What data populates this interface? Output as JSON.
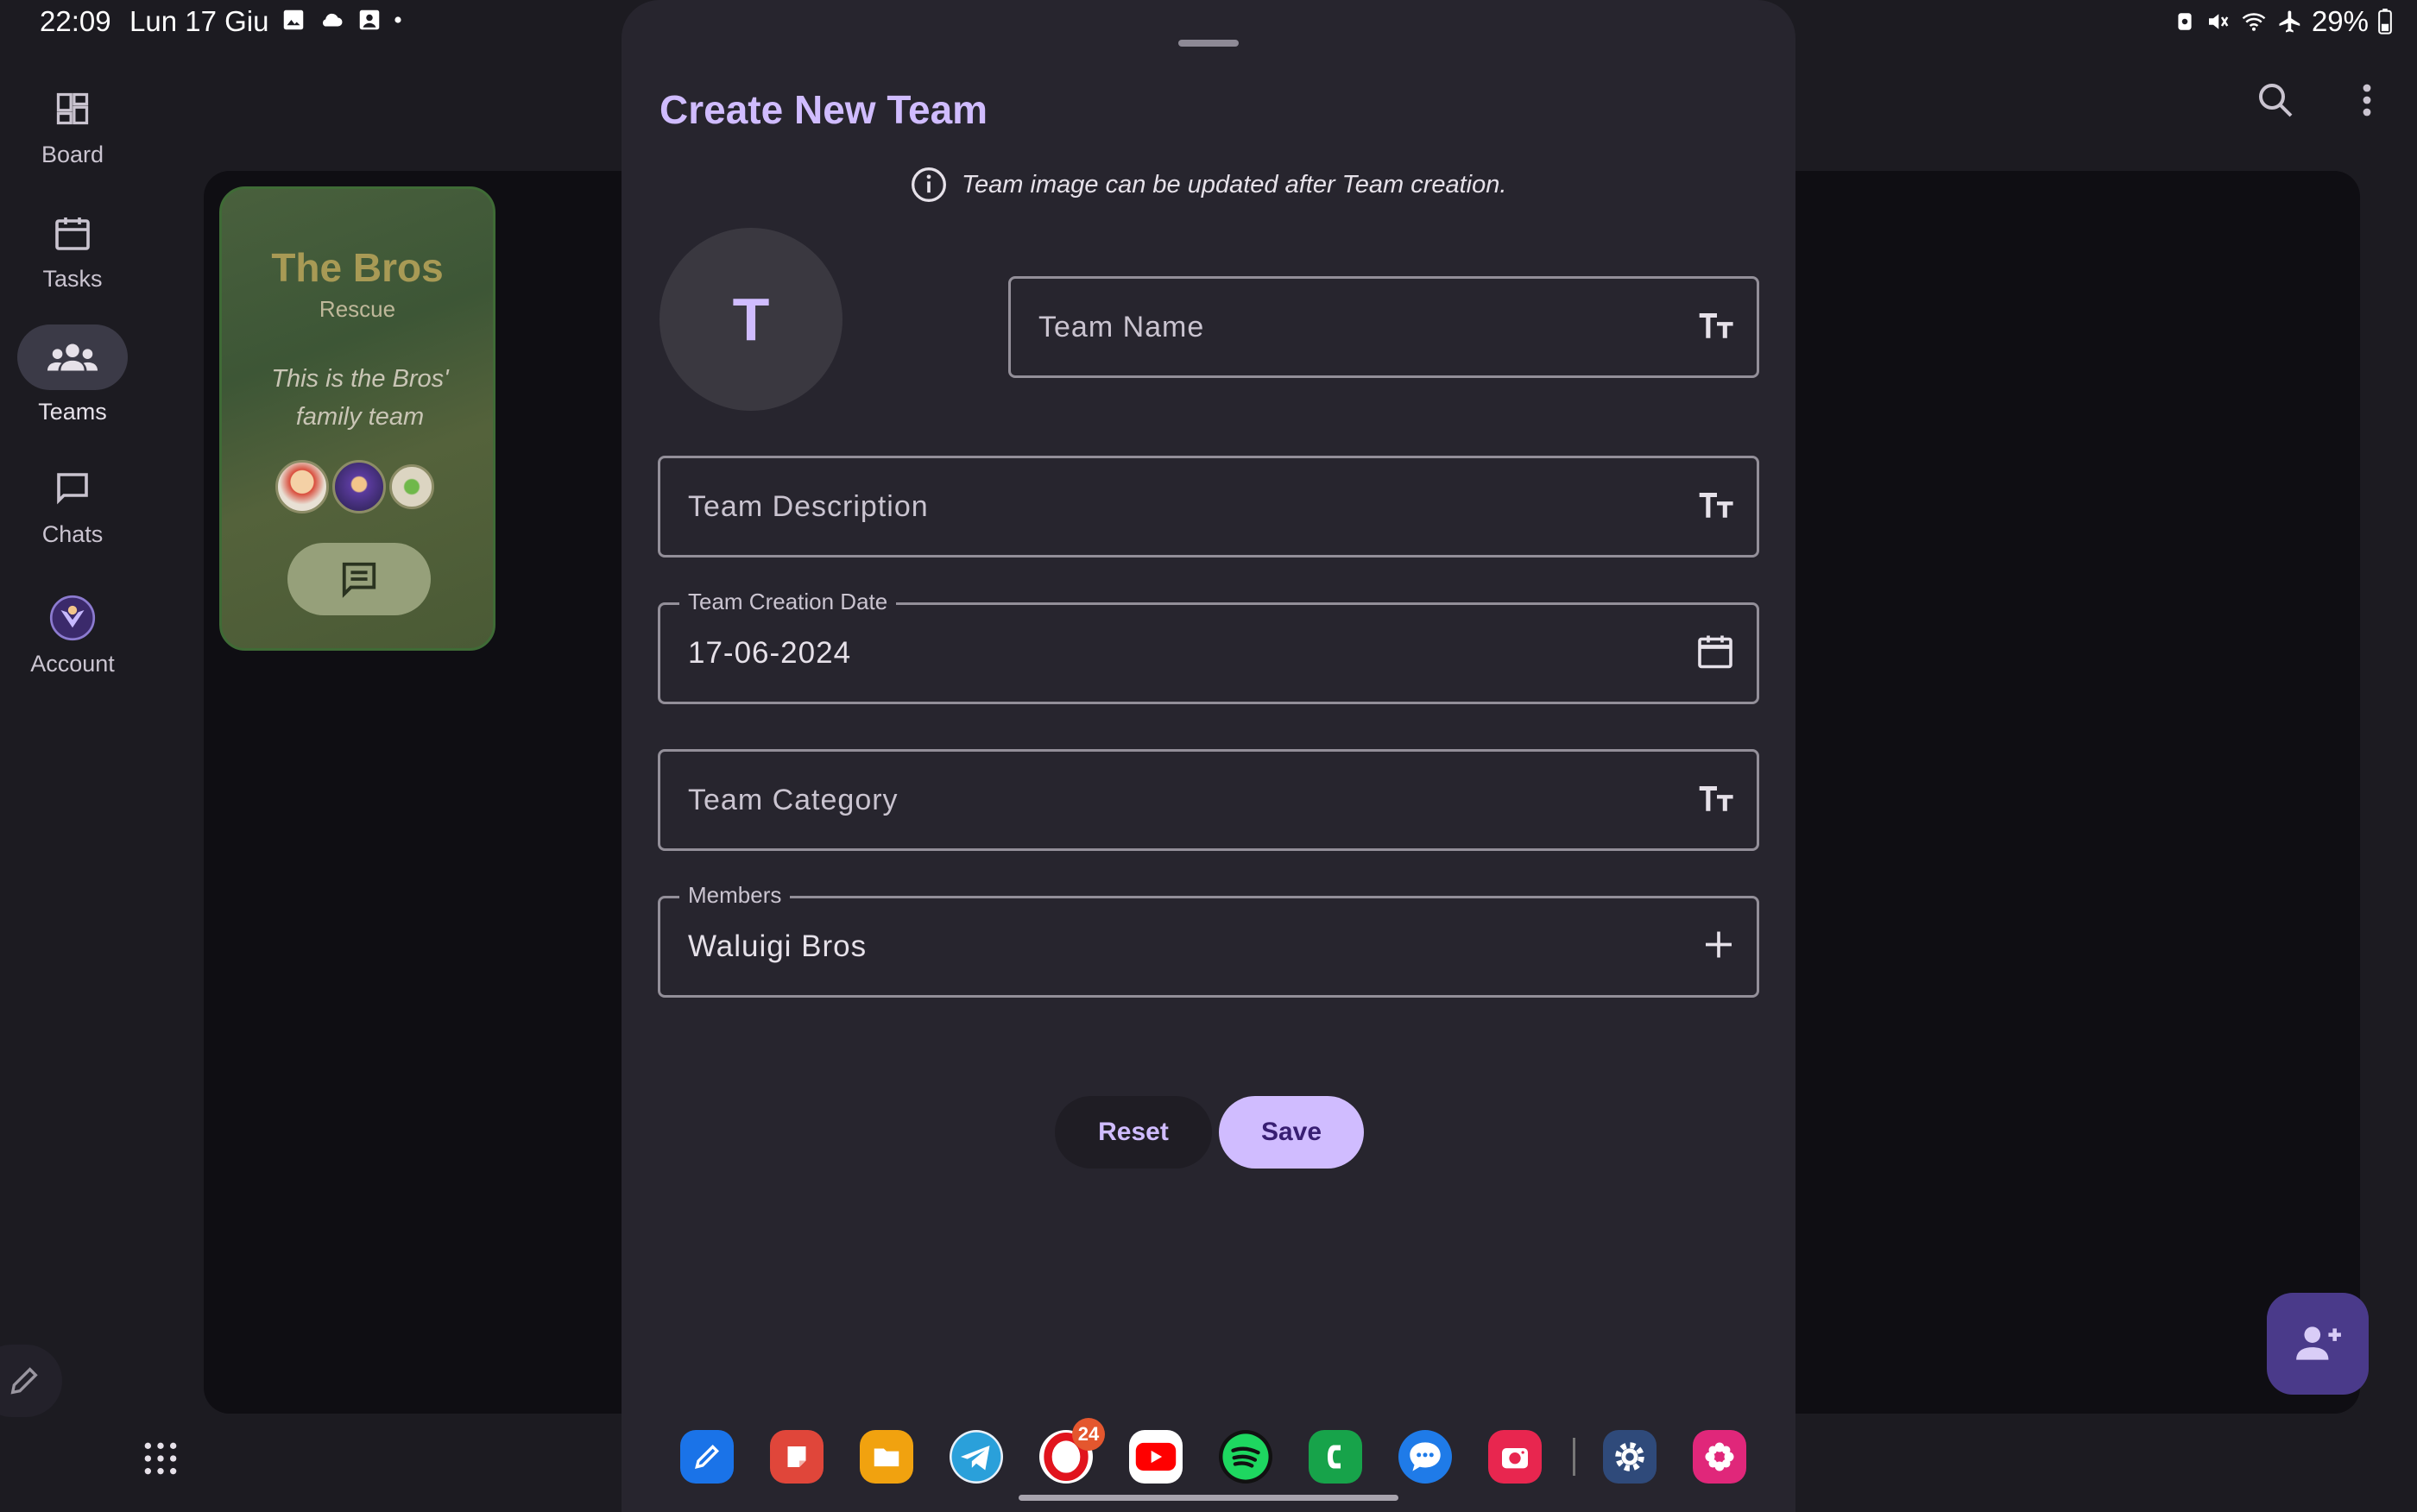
{
  "status_bar": {
    "time": "22:09",
    "date": "Lun 17 Giu",
    "battery": "29%",
    "left_icons": [
      "image-icon",
      "cloud-icon",
      "gallery-icon",
      "dot-icon"
    ],
    "right_icons": [
      "alarm-icon",
      "mute-icon",
      "wifi-icon",
      "airplane-icon",
      "battery-icon"
    ]
  },
  "nav_rail": {
    "items": [
      {
        "label": "Board",
        "icon": "dashboard-icon",
        "active": false
      },
      {
        "label": "Tasks",
        "icon": "calendar-icon",
        "active": false
      },
      {
        "label": "Teams",
        "icon": "groups-icon",
        "active": true
      },
      {
        "label": "Chats",
        "icon": "chat-icon",
        "active": false
      },
      {
        "label": "Account",
        "icon": "avatar",
        "active": false
      }
    ]
  },
  "top_actions": {
    "search_icon": "search-icon",
    "menu_icon": "more-vert-icon"
  },
  "team_card": {
    "title": "The Bros",
    "category": "Rescue",
    "description": "This is the Bros' family team"
  },
  "sheet": {
    "title": "Create New Team",
    "info": "Team image can be updated after Team creation.",
    "avatar_letter": "T",
    "fields": {
      "team_name": {
        "placeholder": "Team Name"
      },
      "team_description": {
        "placeholder": "Team Description"
      },
      "team_creation_date": {
        "label": "Team Creation Date",
        "value": "17-06-2024"
      },
      "team_category": {
        "placeholder": "Team Category"
      },
      "members": {
        "label": "Members",
        "value": "Waluigi Bros"
      }
    },
    "buttons": {
      "reset": "Reset",
      "save": "Save"
    }
  },
  "dock": {
    "apps": [
      "notes-icon",
      "docs-icon",
      "files-icon",
      "telegram-icon",
      "opera-icon",
      "youtube-icon",
      "spotify-icon",
      "phone-icon",
      "messages-icon",
      "camera-icon",
      "settings-icon",
      "flower-icon"
    ],
    "opera_badge": "24"
  },
  "colors": {
    "accent": "#d0bcff",
    "background": "#1c1b21",
    "sheet": "#27252e",
    "fab": "#4a3a8a"
  }
}
